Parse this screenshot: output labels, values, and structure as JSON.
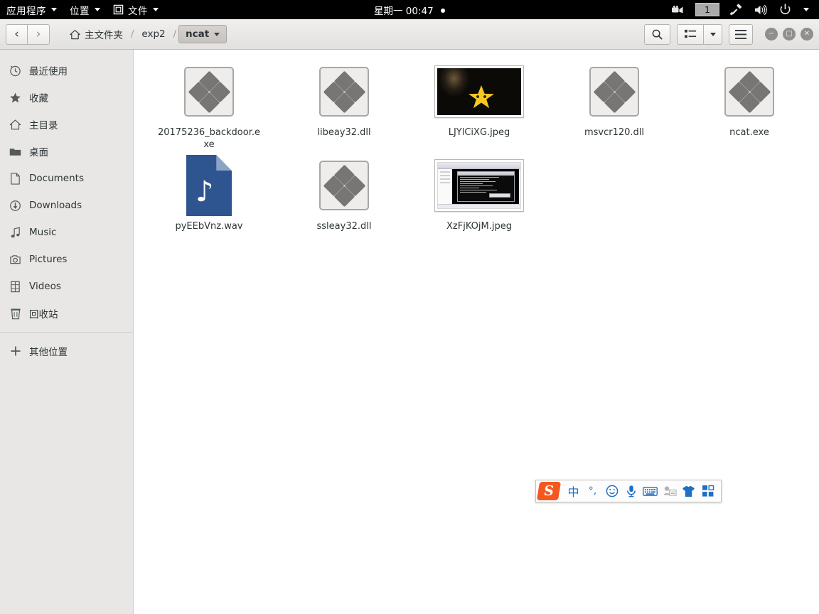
{
  "top_panel": {
    "menus": [
      {
        "label": "应用程序",
        "icon": "",
        "name": "applications-menu"
      },
      {
        "label": "位置",
        "icon": "",
        "name": "places-menu"
      },
      {
        "label": "文件",
        "icon": "window-icon",
        "name": "files-menu"
      }
    ],
    "clock": "星期一 00:47",
    "tray": {
      "screencast_icon": "camera-video-icon",
      "workspace": "1",
      "plug_icon": "plug-icon",
      "volume_icon": "speaker-icon",
      "power_icon": "power-icon",
      "menu_caret": "chevron-down-icon"
    }
  },
  "headerbar": {
    "back_label": "‹",
    "forward_label": "›",
    "breadcrumb": [
      {
        "label": "主文件夹",
        "icon": "home-icon",
        "active": false
      },
      {
        "label": "exp2",
        "icon": "",
        "active": false
      },
      {
        "label": "ncat",
        "icon": "",
        "active": true
      }
    ],
    "separator": "/",
    "search_icon": "search-icon",
    "view_icon": "list-view-icon",
    "view_caret": "chevron-down-icon",
    "menu_icon": "hamburger-menu-icon",
    "window_controls": {
      "minimize": "−",
      "maximize": "□",
      "close": "✕"
    }
  },
  "sidebar": {
    "items": [
      {
        "label": "最近使用",
        "icon": "clock-icon"
      },
      {
        "label": "收藏",
        "icon": "star-icon"
      },
      {
        "label": "主目录",
        "icon": "home-icon"
      },
      {
        "label": "桌面",
        "icon": "folder-icon"
      },
      {
        "label": "Documents",
        "icon": "document-icon"
      },
      {
        "label": "Downloads",
        "icon": "download-icon"
      },
      {
        "label": "Music",
        "icon": "music-note-icon"
      },
      {
        "label": "Pictures",
        "icon": "camera-icon"
      },
      {
        "label": "Videos",
        "icon": "film-icon"
      },
      {
        "label": "回收站",
        "icon": "trash-icon"
      }
    ],
    "other_locations": {
      "label": "其他位置",
      "icon": "plus-icon"
    }
  },
  "files": [
    {
      "name": "20175236_backdoor.exe",
      "type": "binary"
    },
    {
      "name": "libeay32.dll",
      "type": "binary"
    },
    {
      "name": "LJYlCiXG.jpeg",
      "type": "photo-dark"
    },
    {
      "name": "msvcr120.dll",
      "type": "binary"
    },
    {
      "name": "ncat.exe",
      "type": "binary"
    },
    {
      "name": "pyEEbVnz.wav",
      "type": "audio"
    },
    {
      "name": "ssleay32.dll",
      "type": "binary"
    },
    {
      "name": "XzFjKOjM.jpeg",
      "type": "photo-screenshot"
    }
  ],
  "ime": {
    "logo": "sogou-logo",
    "items": [
      {
        "label": "中",
        "name": "chinese-mode-icon",
        "dim": false
      },
      {
        "label": "°,",
        "name": "punctuation-mode-icon",
        "dim": false
      },
      {
        "label": "☺",
        "name": "emoji-icon",
        "dim": false
      },
      {
        "label": "",
        "name": "microphone-icon",
        "dim": false
      },
      {
        "label": "",
        "name": "keyboard-icon",
        "dim": false
      },
      {
        "label": "",
        "name": "user-card-icon",
        "dim": true
      },
      {
        "label": "",
        "name": "skin-tshirt-icon",
        "dim": false
      },
      {
        "label": "",
        "name": "toolbox-grid-icon",
        "dim": false
      }
    ]
  },
  "colors": {
    "panel_bg": "#000000",
    "sidebar_bg": "#e8e7e5",
    "content_bg": "#ffffff",
    "accent_blue": "#1f6fc4",
    "sogou_orange": "#f5581f",
    "audio_icon_blue": "#2e5590"
  }
}
